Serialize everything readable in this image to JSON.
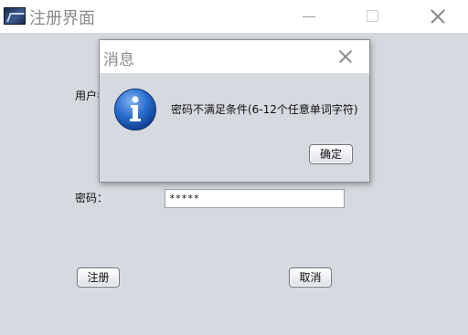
{
  "window": {
    "title": "注册界面"
  },
  "form": {
    "username_label": "用户名：",
    "password_label": "密码：",
    "password_value": "*****",
    "register_label": "注册",
    "cancel_label": "取消"
  },
  "dialog": {
    "title": "消息",
    "message": "密码不满足条件(6-12个任意单词字符)",
    "ok_label": "确定",
    "icon": "info-icon"
  },
  "colors": {
    "background": "#d6d9df",
    "titlebar": "#ffffff",
    "info_icon_blue": "#1f5fbf"
  }
}
